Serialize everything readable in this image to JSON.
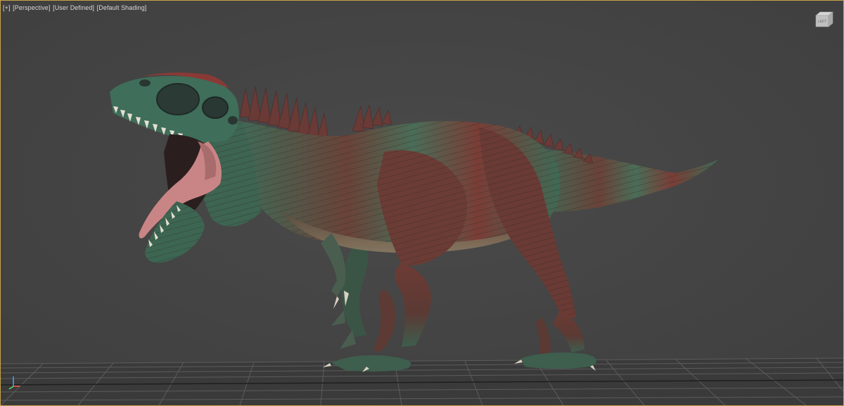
{
  "viewport": {
    "labels": {
      "plus": "[+]",
      "view": "[Perspective]",
      "shading_preset": "[User Defined]",
      "shading": "[Default Shading]"
    },
    "viewcube_face": "LEFT",
    "colors": {
      "background": "#444444",
      "border_active": "#c8a24a",
      "grid_line": "#5a5a5a",
      "model_green": "#3d6a55",
      "model_red": "#7a3a34",
      "tongue": "#c48080"
    },
    "icons": [
      "viewcube-icon",
      "axis-tripod-icon"
    ]
  }
}
